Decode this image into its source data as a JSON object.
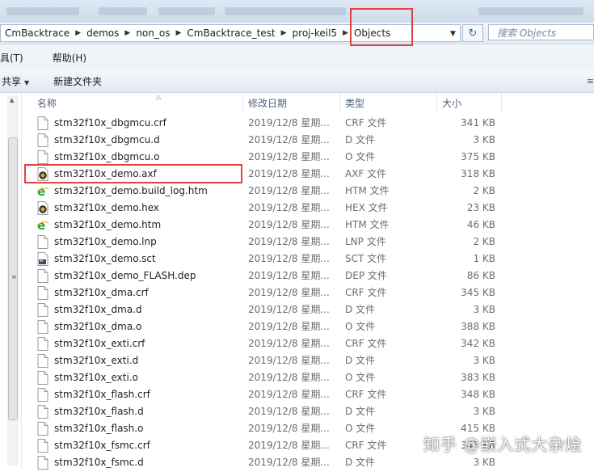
{
  "breadcrumb": [
    "CmBacktrace",
    "demos",
    "non_os",
    "CmBacktrace_test",
    "proj-keil5",
    "Objects"
  ],
  "search": {
    "placeholder": "搜索 Objects"
  },
  "menu": {
    "tools": "具(T)",
    "help": "帮助(H)"
  },
  "toolbar": {
    "share": "共享",
    "new_folder": "新建文件夹"
  },
  "columns": {
    "name": "名称",
    "date": "修改日期",
    "type": "类型",
    "size": "大小"
  },
  "files": [
    {
      "name": "stm32f10x_dbgmcu.crf",
      "date": "2019/12/8 星期...",
      "type": "CRF 文件",
      "size": "341 KB",
      "icon": "file-icon"
    },
    {
      "name": "stm32f10x_dbgmcu.d",
      "date": "2019/12/8 星期...",
      "type": "D 文件",
      "size": "3 KB",
      "icon": "file-icon"
    },
    {
      "name": "stm32f10x_dbgmcu.o",
      "date": "2019/12/8 星期...",
      "type": "O 文件",
      "size": "375 KB",
      "icon": "file-icon"
    },
    {
      "name": "stm32f10x_demo.axf",
      "date": "2019/12/8 星期...",
      "type": "AXF 文件",
      "size": "318 KB",
      "icon": "keil-file-icon"
    },
    {
      "name": "stm32f10x_demo.build_log.htm",
      "date": "2019/12/8 星期...",
      "type": "HTM 文件",
      "size": "2 KB",
      "icon": "ie-html-icon"
    },
    {
      "name": "stm32f10x_demo.hex",
      "date": "2019/12/8 星期...",
      "type": "HEX 文件",
      "size": "23 KB",
      "icon": "keil-file-icon"
    },
    {
      "name": "stm32f10x_demo.htm",
      "date": "2019/12/8 星期...",
      "type": "HTM 文件",
      "size": "46 KB",
      "icon": "ie-html-icon"
    },
    {
      "name": "stm32f10x_demo.lnp",
      "date": "2019/12/8 星期...",
      "type": "LNP 文件",
      "size": "2 KB",
      "icon": "file-icon"
    },
    {
      "name": "stm32f10x_demo.sct",
      "date": "2019/12/8 星期...",
      "type": "SCT 文件",
      "size": "1 KB",
      "icon": "script-file-icon"
    },
    {
      "name": "stm32f10x_demo_FLASH.dep",
      "date": "2019/12/8 星期...",
      "type": "DEP 文件",
      "size": "86 KB",
      "icon": "file-icon"
    },
    {
      "name": "stm32f10x_dma.crf",
      "date": "2019/12/8 星期...",
      "type": "CRF 文件",
      "size": "345 KB",
      "icon": "file-icon"
    },
    {
      "name": "stm32f10x_dma.d",
      "date": "2019/12/8 星期...",
      "type": "D 文件",
      "size": "3 KB",
      "icon": "file-icon"
    },
    {
      "name": "stm32f10x_dma.o",
      "date": "2019/12/8 星期...",
      "type": "O 文件",
      "size": "388 KB",
      "icon": "file-icon"
    },
    {
      "name": "stm32f10x_exti.crf",
      "date": "2019/12/8 星期...",
      "type": "CRF 文件",
      "size": "342 KB",
      "icon": "file-icon"
    },
    {
      "name": "stm32f10x_exti.d",
      "date": "2019/12/8 星期...",
      "type": "D 文件",
      "size": "3 KB",
      "icon": "file-icon"
    },
    {
      "name": "stm32f10x_exti.o",
      "date": "2019/12/8 星期...",
      "type": "O 文件",
      "size": "383 KB",
      "icon": "file-icon"
    },
    {
      "name": "stm32f10x_flash.crf",
      "date": "2019/12/8 星期...",
      "type": "CRF 文件",
      "size": "348 KB",
      "icon": "file-icon"
    },
    {
      "name": "stm32f10x_flash.d",
      "date": "2019/12/8 星期...",
      "type": "D 文件",
      "size": "3 KB",
      "icon": "file-icon"
    },
    {
      "name": "stm32f10x_flash.o",
      "date": "2019/12/8 星期...",
      "type": "O 文件",
      "size": "415 KB",
      "icon": "file-icon"
    },
    {
      "name": "stm32f10x_fsmc.crf",
      "date": "2019/12/8 星期...",
      "type": "CRF 文件",
      "size": "345 KB",
      "icon": "file-icon"
    },
    {
      "name": "stm32f10x_fsmc.d",
      "date": "2019/12/8 星期...",
      "type": "D 文件",
      "size": "3 KB",
      "icon": "file-icon"
    }
  ],
  "watermark": "知乎 @嵌入式大杂烩",
  "colors": {
    "highlight": "#e0443e",
    "header_text": "#4c607a",
    "meta_text": "#6d6d6d"
  }
}
